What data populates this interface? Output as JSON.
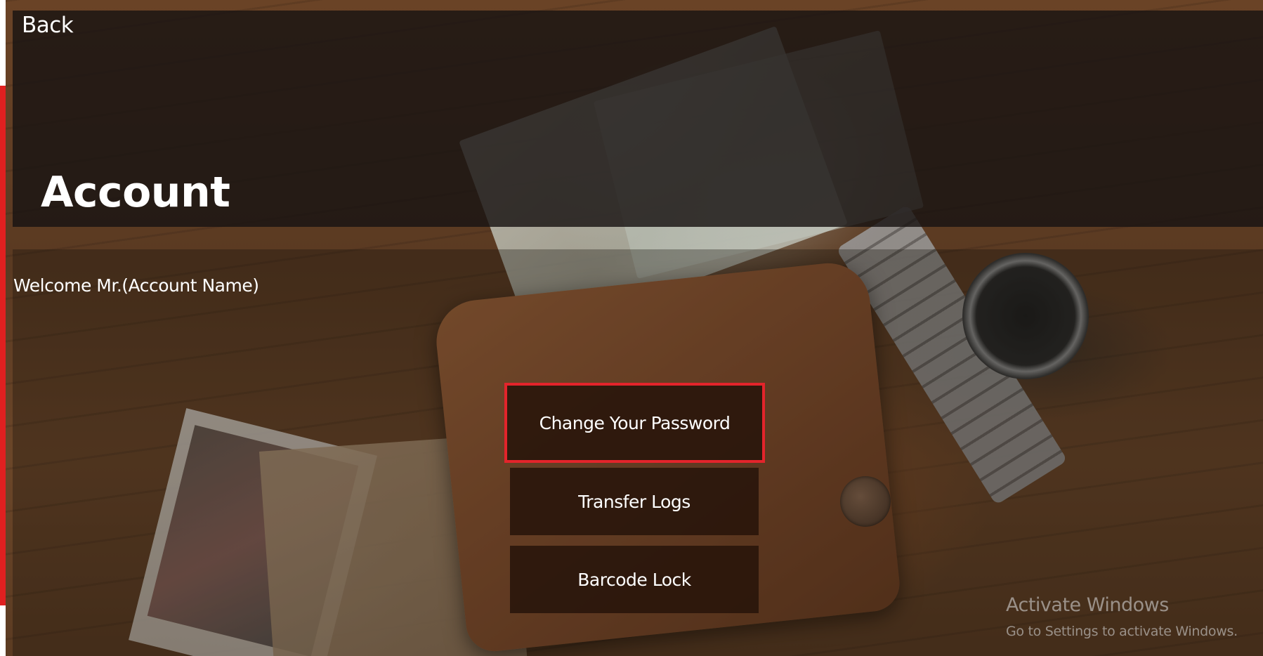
{
  "nav": {
    "back_label": "Back"
  },
  "page": {
    "title": "Account",
    "welcome": "Welcome Mr.(Account Name)"
  },
  "menu": {
    "items": [
      {
        "label": "Change Your Password",
        "selected": true
      },
      {
        "label": "Transfer Logs",
        "selected": false
      },
      {
        "label": "Barcode Lock",
        "selected": false
      }
    ]
  },
  "watermark": {
    "title": "Activate Windows",
    "subtitle": "Go to Settings to activate Windows."
  },
  "colors": {
    "accent_red": "#e3242b",
    "header_overlay": "#19140e",
    "button_bg": "#28140a",
    "text": "#ffffff"
  }
}
